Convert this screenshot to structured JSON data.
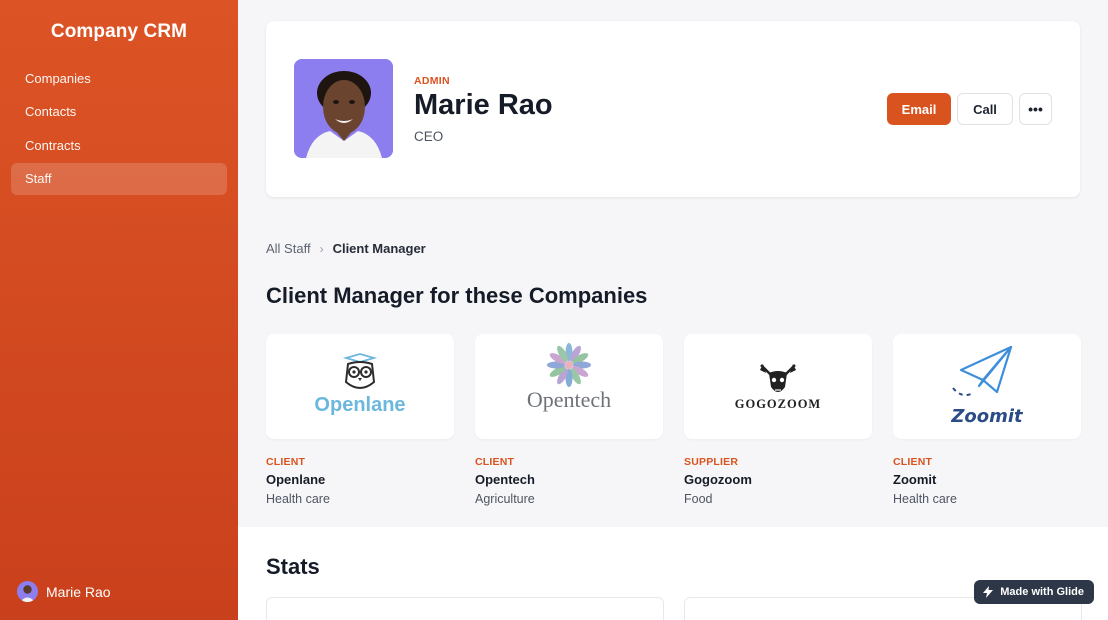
{
  "app": {
    "title": "Company CRM"
  },
  "sidebar": {
    "items": [
      {
        "label": "Companies",
        "active": false
      },
      {
        "label": "Contacts",
        "active": false
      },
      {
        "label": "Contracts",
        "active": false
      },
      {
        "label": "Staff",
        "active": true
      }
    ],
    "user": {
      "name": "Marie Rao"
    }
  },
  "profile": {
    "role": "ADMIN",
    "name": "Marie Rao",
    "title": "CEO",
    "actions": {
      "email": "Email",
      "call": "Call",
      "more": "•••"
    }
  },
  "breadcrumb": {
    "parent": "All Staff",
    "separator": "›",
    "current": "Client Manager"
  },
  "section": {
    "title": "Client Manager for these Companies"
  },
  "companies": [
    {
      "type": "CLIENT",
      "name": "Openlane",
      "industry": "Health care",
      "logo_text": "Openlane",
      "logo_icon": "owl-icon"
    },
    {
      "type": "CLIENT",
      "name": "Opentech",
      "industry": "Agriculture",
      "logo_text": "Opentech",
      "logo_icon": "flower-icon"
    },
    {
      "type": "SUPPLIER",
      "name": "Gogozoom",
      "industry": "Food",
      "logo_text": "GOGOZOOM",
      "logo_icon": "bull-skull-icon"
    },
    {
      "type": "CLIENT",
      "name": "Zoomit",
      "industry": "Health care",
      "logo_text": "Zoomit",
      "logo_icon": "paper-plane-icon"
    }
  ],
  "stats": {
    "title": "Stats"
  },
  "badge": {
    "label": "Made with Glide",
    "icon": "glide-bolt-icon"
  },
  "colors": {
    "accent": "#d9531f",
    "sidebar": "#d24a20",
    "avatar_bg": "#8d7ef0",
    "badge_bg": "#2d3748"
  }
}
